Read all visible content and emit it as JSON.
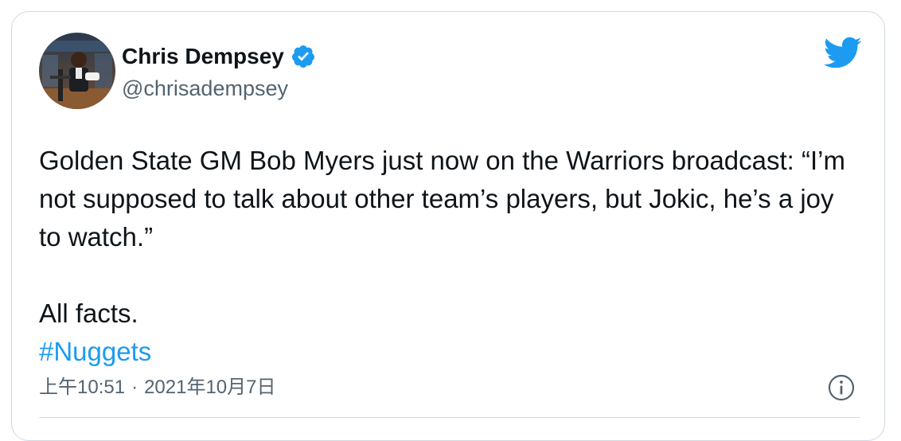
{
  "author": {
    "name": "Chris Dempsey",
    "handle": "@chrisadempsey",
    "verified": true
  },
  "tweet": {
    "body": "Golden State GM Bob Myers just now on the Warriors broadcast: “I’m not supposed to talk about other team’s players, but Jokic, he’s a joy to watch.”",
    "line2": "All facts.",
    "hashtag": "#Nuggets"
  },
  "meta": {
    "time": "上午10:51",
    "separator": "·",
    "date": "2021年10月7日"
  },
  "icons": {
    "brand": "twitter-bird-icon",
    "verified": "verified-badge-icon",
    "info": "info-icon"
  },
  "colors": {
    "brand_blue": "#1d9bf0",
    "text_primary": "#0f1419",
    "text_secondary": "#536471",
    "border": "#cfd9de"
  }
}
